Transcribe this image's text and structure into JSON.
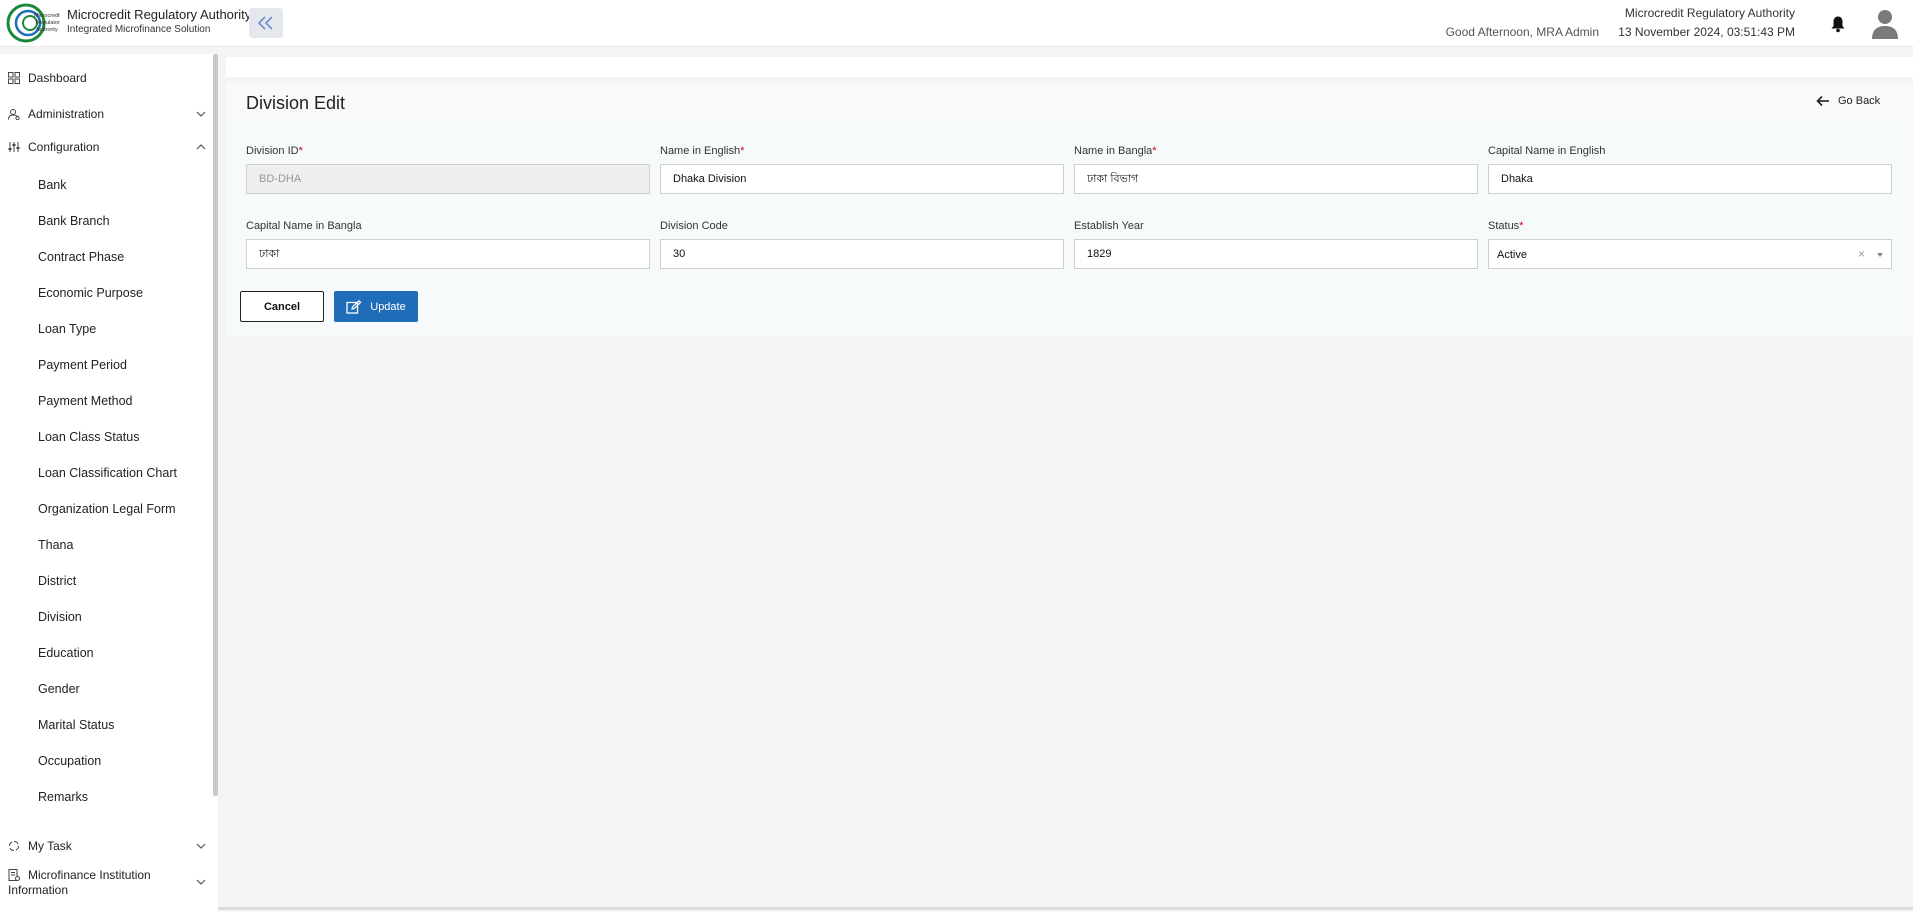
{
  "header": {
    "logo_text": "Microcredit Regulatory Authority",
    "brand_title": "Microcredit Regulatory Authority",
    "brand_subtitle": "Integrated Microfinance Solution",
    "greeting": "Good Afternoon, MRA Admin",
    "org_name": "Microcredit Regulatory Authority",
    "datetime": "13 November 2024, 03:51:43 PM"
  },
  "sidebar": {
    "dashboard": "Dashboard",
    "administration": "Administration",
    "configuration": "Configuration",
    "config_items": [
      "Bank",
      "Bank Branch",
      "Contract Phase",
      "Economic Purpose",
      "Loan Type",
      "Payment Period",
      "Payment Method",
      "Loan Class Status",
      "Loan Classification Chart",
      "Organization Legal Form",
      "Thana",
      "District",
      "Division",
      "Education",
      "Gender",
      "Marital Status",
      "Occupation",
      "Remarks"
    ],
    "my_task": "My Task",
    "mfi_line1": "Microfinance Institution",
    "mfi_line2": "Information"
  },
  "page": {
    "title": "Division Edit",
    "go_back": "Go Back"
  },
  "form": {
    "division_id": {
      "label": "Division ID",
      "value": "BD-DHA"
    },
    "name_en": {
      "label": "Name in English",
      "value": "Dhaka Division"
    },
    "name_bn": {
      "label": "Name in Bangla",
      "value": "ঢাকা বিভাগ"
    },
    "capital_en": {
      "label": "Capital Name in English",
      "value": "Dhaka"
    },
    "capital_bn": {
      "label": "Capital Name in Bangla",
      "value": "ঢাকা"
    },
    "division_code": {
      "label": "Division Code",
      "value": "30"
    },
    "establish_year": {
      "label": "Establish Year",
      "value": "1829"
    },
    "status": {
      "label": "Status",
      "value": "Active"
    },
    "required_mark": "*"
  },
  "actions": {
    "cancel": "Cancel",
    "update": "Update"
  },
  "colors": {
    "primary": "#1f6db8",
    "required": "#d0021b",
    "logo_green": "#1a8a3a"
  }
}
